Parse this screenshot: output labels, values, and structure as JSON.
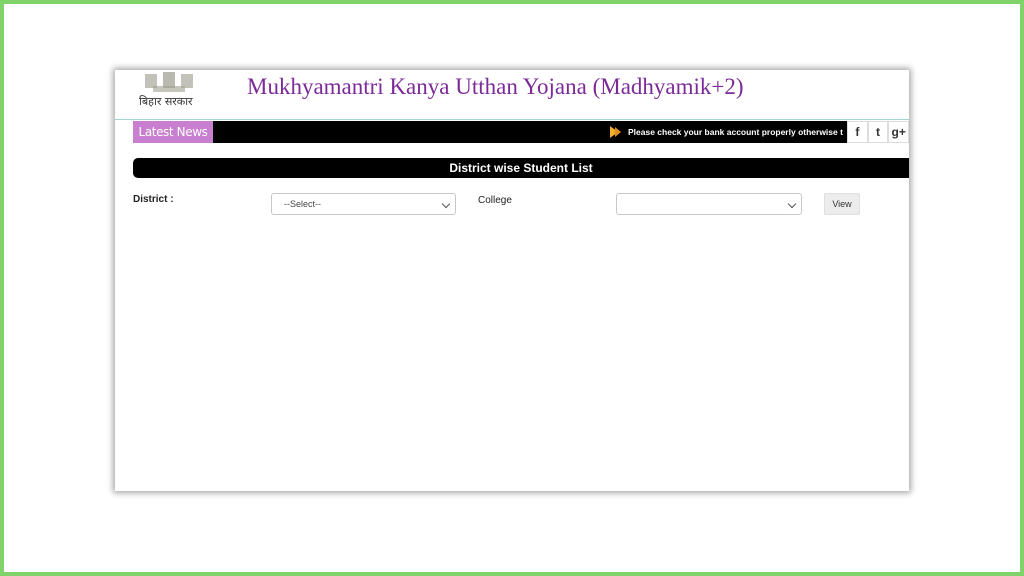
{
  "header": {
    "emblem_text": "बिहार सरकार",
    "site_title": "Mukhyamantri Kanya Utthan Yojana (Madhyamik+2)"
  },
  "news": {
    "label": "Latest News",
    "ticker": "Please check your bank account properly otherwise t",
    "social": [
      "f",
      "t",
      "g+"
    ]
  },
  "panel": {
    "title": "District wise Student List"
  },
  "form": {
    "district_label": "District :",
    "district_value": "--Select--",
    "college_label": "College",
    "college_value": "",
    "view_label": "View"
  },
  "colors": {
    "title": "#7b2a98",
    "news_label_bg": "#c97fcf",
    "frame_border": "#7fd36a"
  }
}
